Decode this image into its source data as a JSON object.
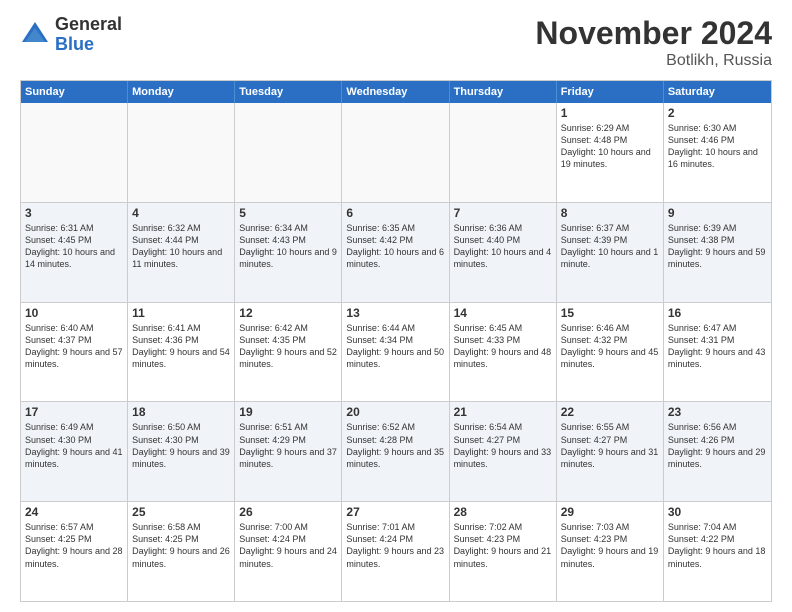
{
  "logo": {
    "general": "General",
    "blue": "Blue"
  },
  "header": {
    "month": "November 2024",
    "location": "Botlikh, Russia"
  },
  "weekdays": [
    "Sunday",
    "Monday",
    "Tuesday",
    "Wednesday",
    "Thursday",
    "Friday",
    "Saturday"
  ],
  "rows": [
    [
      {
        "day": "",
        "empty": true
      },
      {
        "day": "",
        "empty": true
      },
      {
        "day": "",
        "empty": true
      },
      {
        "day": "",
        "empty": true
      },
      {
        "day": "",
        "empty": true
      },
      {
        "day": "1",
        "rise": "6:29 AM",
        "set": "4:48 PM",
        "daylight": "10 hours and 19 minutes."
      },
      {
        "day": "2",
        "rise": "6:30 AM",
        "set": "4:46 PM",
        "daylight": "10 hours and 16 minutes."
      }
    ],
    [
      {
        "day": "3",
        "rise": "6:31 AM",
        "set": "4:45 PM",
        "daylight": "10 hours and 14 minutes."
      },
      {
        "day": "4",
        "rise": "6:32 AM",
        "set": "4:44 PM",
        "daylight": "10 hours and 11 minutes."
      },
      {
        "day": "5",
        "rise": "6:34 AM",
        "set": "4:43 PM",
        "daylight": "10 hours and 9 minutes."
      },
      {
        "day": "6",
        "rise": "6:35 AM",
        "set": "4:42 PM",
        "daylight": "10 hours and 6 minutes."
      },
      {
        "day": "7",
        "rise": "6:36 AM",
        "set": "4:40 PM",
        "daylight": "10 hours and 4 minutes."
      },
      {
        "day": "8",
        "rise": "6:37 AM",
        "set": "4:39 PM",
        "daylight": "10 hours and 1 minute."
      },
      {
        "day": "9",
        "rise": "6:39 AM",
        "set": "4:38 PM",
        "daylight": "9 hours and 59 minutes."
      }
    ],
    [
      {
        "day": "10",
        "rise": "6:40 AM",
        "set": "4:37 PM",
        "daylight": "9 hours and 57 minutes."
      },
      {
        "day": "11",
        "rise": "6:41 AM",
        "set": "4:36 PM",
        "daylight": "9 hours and 54 minutes."
      },
      {
        "day": "12",
        "rise": "6:42 AM",
        "set": "4:35 PM",
        "daylight": "9 hours and 52 minutes."
      },
      {
        "day": "13",
        "rise": "6:44 AM",
        "set": "4:34 PM",
        "daylight": "9 hours and 50 minutes."
      },
      {
        "day": "14",
        "rise": "6:45 AM",
        "set": "4:33 PM",
        "daylight": "9 hours and 48 minutes."
      },
      {
        "day": "15",
        "rise": "6:46 AM",
        "set": "4:32 PM",
        "daylight": "9 hours and 45 minutes."
      },
      {
        "day": "16",
        "rise": "6:47 AM",
        "set": "4:31 PM",
        "daylight": "9 hours and 43 minutes."
      }
    ],
    [
      {
        "day": "17",
        "rise": "6:49 AM",
        "set": "4:30 PM",
        "daylight": "9 hours and 41 minutes."
      },
      {
        "day": "18",
        "rise": "6:50 AM",
        "set": "4:30 PM",
        "daylight": "9 hours and 39 minutes."
      },
      {
        "day": "19",
        "rise": "6:51 AM",
        "set": "4:29 PM",
        "daylight": "9 hours and 37 minutes."
      },
      {
        "day": "20",
        "rise": "6:52 AM",
        "set": "4:28 PM",
        "daylight": "9 hours and 35 minutes."
      },
      {
        "day": "21",
        "rise": "6:54 AM",
        "set": "4:27 PM",
        "daylight": "9 hours and 33 minutes."
      },
      {
        "day": "22",
        "rise": "6:55 AM",
        "set": "4:27 PM",
        "daylight": "9 hours and 31 minutes."
      },
      {
        "day": "23",
        "rise": "6:56 AM",
        "set": "4:26 PM",
        "daylight": "9 hours and 29 minutes."
      }
    ],
    [
      {
        "day": "24",
        "rise": "6:57 AM",
        "set": "4:25 PM",
        "daylight": "9 hours and 28 minutes."
      },
      {
        "day": "25",
        "rise": "6:58 AM",
        "set": "4:25 PM",
        "daylight": "9 hours and 26 minutes."
      },
      {
        "day": "26",
        "rise": "7:00 AM",
        "set": "4:24 PM",
        "daylight": "9 hours and 24 minutes."
      },
      {
        "day": "27",
        "rise": "7:01 AM",
        "set": "4:24 PM",
        "daylight": "9 hours and 23 minutes."
      },
      {
        "day": "28",
        "rise": "7:02 AM",
        "set": "4:23 PM",
        "daylight": "9 hours and 21 minutes."
      },
      {
        "day": "29",
        "rise": "7:03 AM",
        "set": "4:23 PM",
        "daylight": "9 hours and 19 minutes."
      },
      {
        "day": "30",
        "rise": "7:04 AM",
        "set": "4:22 PM",
        "daylight": "9 hours and 18 minutes."
      }
    ]
  ]
}
